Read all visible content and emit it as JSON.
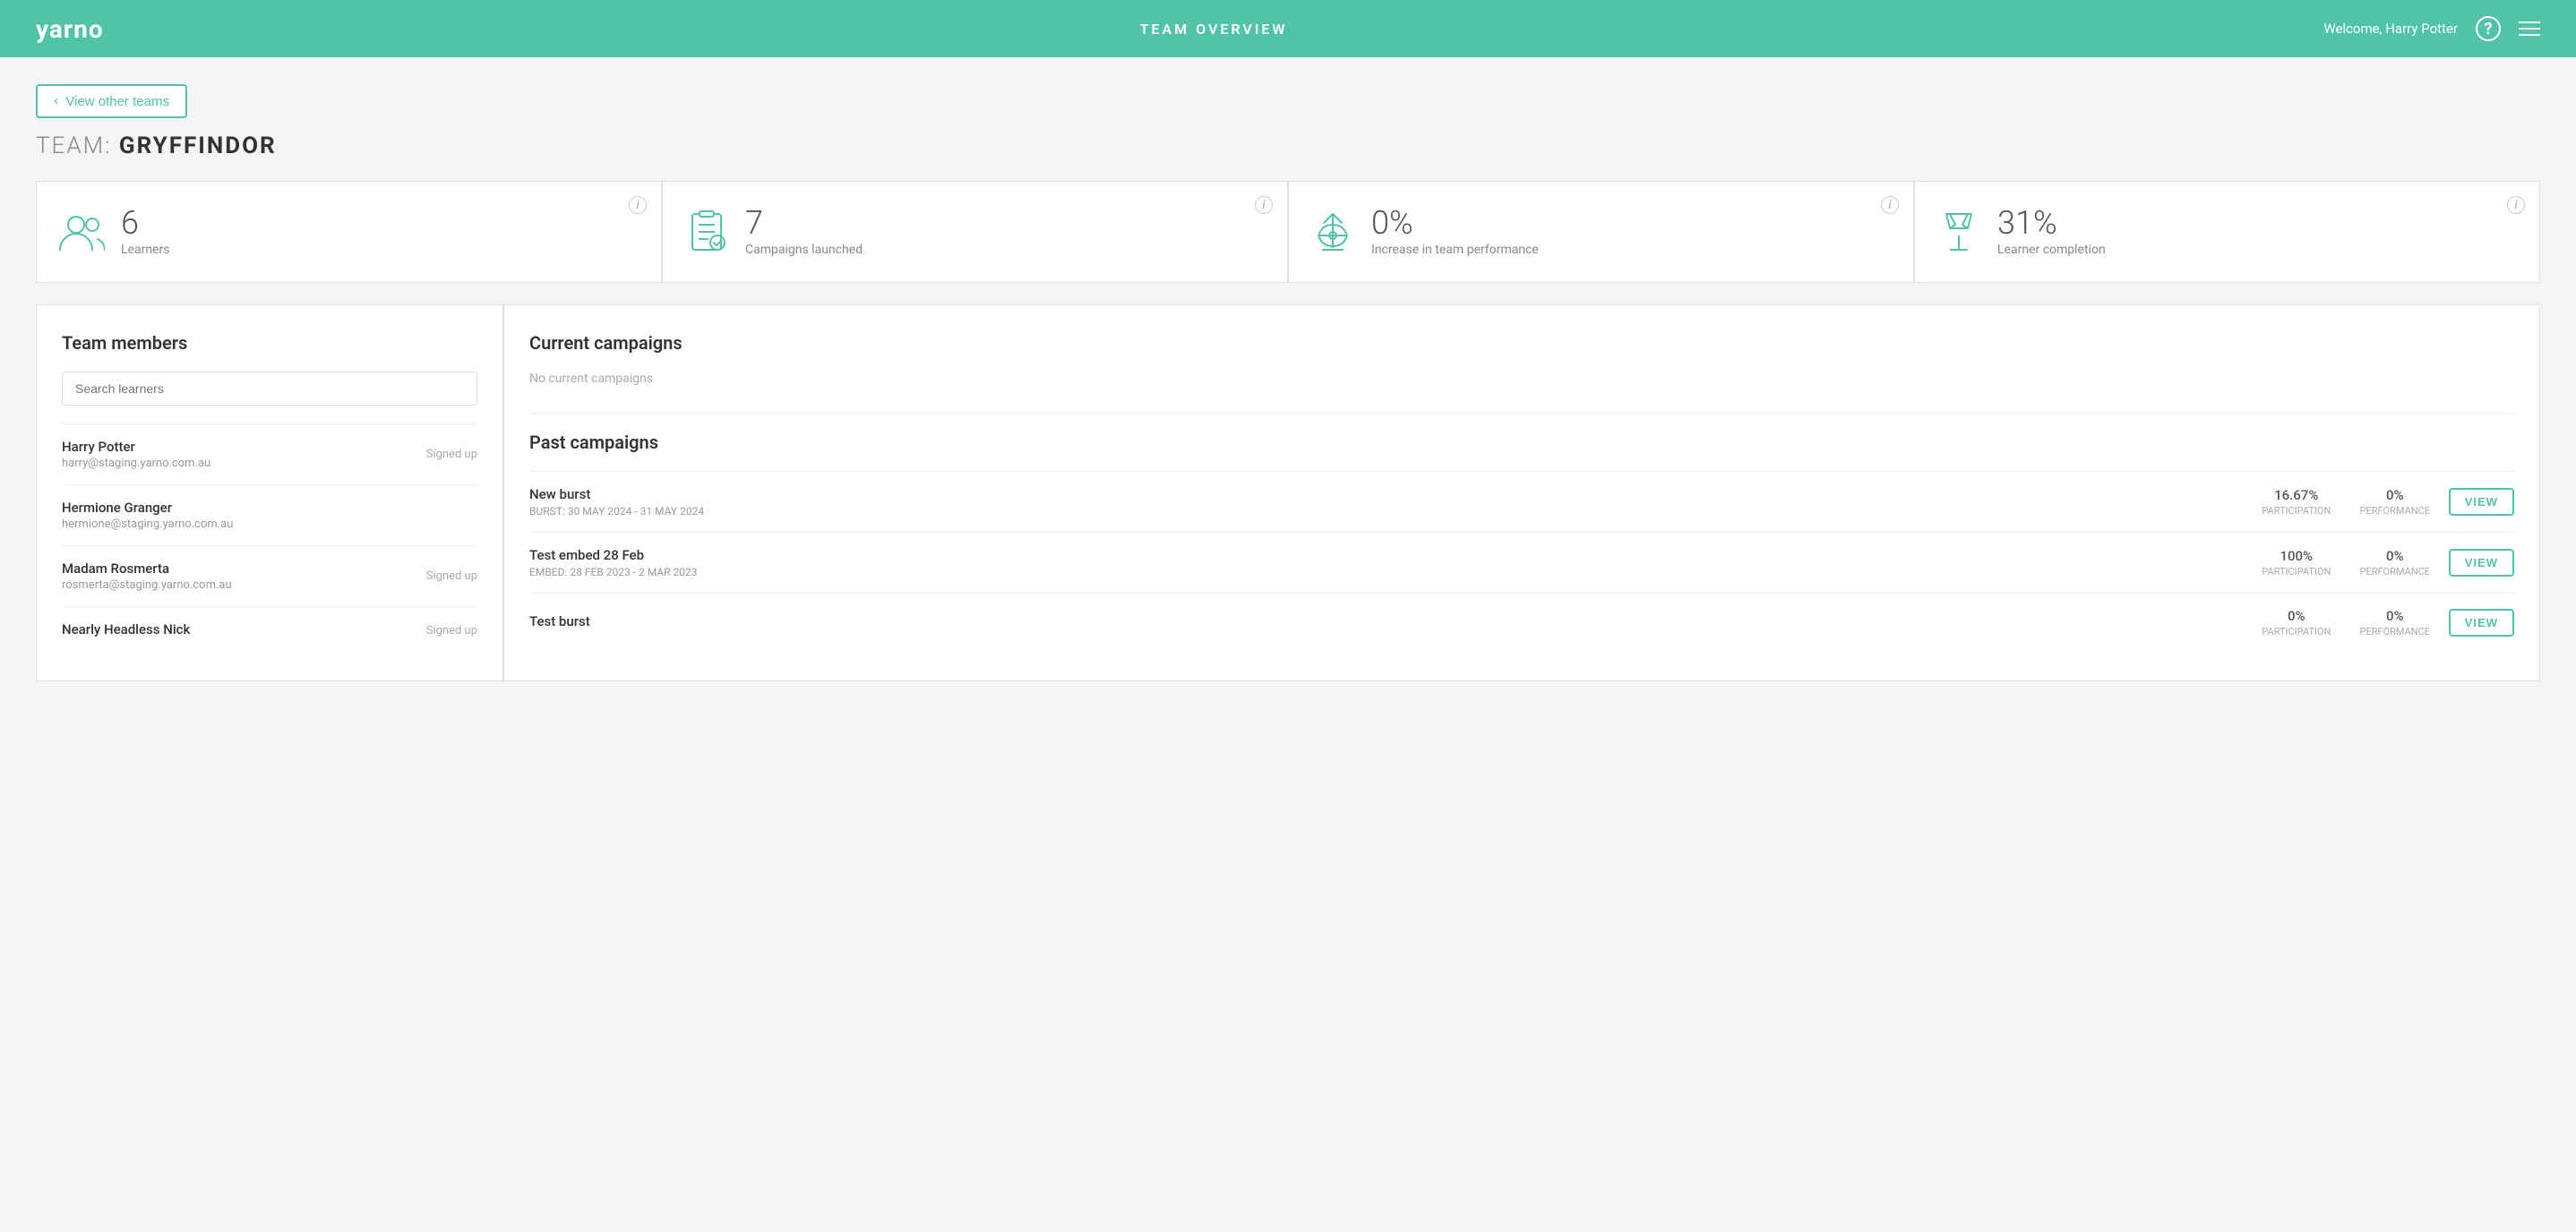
{
  "header": {
    "logo": "yarno",
    "title": "TEAM OVERVIEW",
    "welcome": "Welcome, Harry Potter",
    "help_label": "?",
    "menu_label": "≡"
  },
  "back_button": {
    "label": "View other teams",
    "arrow": "‹"
  },
  "team": {
    "prefix": "TEAM:",
    "name": "GRYFFINDOR"
  },
  "stats": [
    {
      "id": "learners",
      "number": "6",
      "label": "Learners",
      "info": "i"
    },
    {
      "id": "campaigns",
      "number": "7",
      "label": "Campaigns launched",
      "info": "i"
    },
    {
      "id": "performance",
      "number": "0%",
      "label": "Increase in team performance",
      "info": "i"
    },
    {
      "id": "completion",
      "number": "31%",
      "label": "Learner completion",
      "info": "i"
    }
  ],
  "team_members": {
    "title": "Team members",
    "search_placeholder": "Search learners",
    "members": [
      {
        "name": "Harry Potter",
        "email": "harry@staging.yarno.com.au",
        "status": "Signed up"
      },
      {
        "name": "Hermione Granger",
        "email": "hermione@staging.yarno.com.au",
        "status": ""
      },
      {
        "name": "Madam Rosmerta",
        "email": "rosmerta@staging.yarno.com.au",
        "status": "Signed up"
      },
      {
        "name": "Nearly Headless Nick",
        "email": "",
        "status": "Signed up"
      }
    ]
  },
  "current_campaigns": {
    "title": "Current campaigns",
    "empty_message": "No current campaigns"
  },
  "past_campaigns": {
    "title": "Past campaigns",
    "campaigns": [
      {
        "name": "New burst",
        "sub": "BURST: 30 May 2024 - 31 May 2024",
        "participation": "16.67%",
        "participation_label": "PARTICIPATION",
        "performance": "0%",
        "performance_label": "PERFORMANCE",
        "view_label": "VIEW"
      },
      {
        "name": "Test embed 28 Feb",
        "sub": "EMBED: 28 Feb 2023 - 2 Mar 2023",
        "participation": "100%",
        "participation_label": "PARTICIPATION",
        "performance": "0%",
        "performance_label": "PERFORMANCE",
        "view_label": "VIEW"
      },
      {
        "name": "Test burst",
        "sub": "",
        "participation": "0%",
        "participation_label": "PARTICIPATION",
        "performance": "0%",
        "performance_label": "PERFORMANCE",
        "view_label": "VIEW"
      }
    ]
  }
}
